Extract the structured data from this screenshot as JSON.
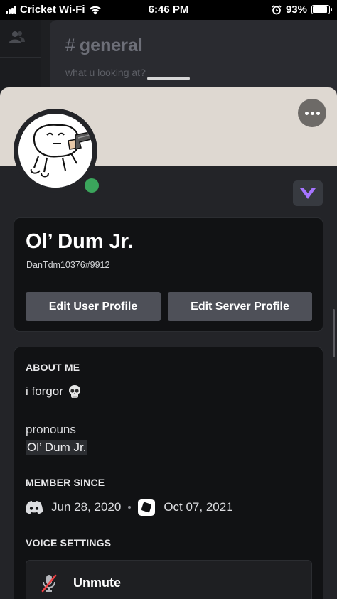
{
  "status_bar": {
    "carrier": "Cricket Wi-Fi",
    "time": "6:46 PM",
    "battery": "93%"
  },
  "background": {
    "channel_name": "general",
    "channel_topic": "what u looking at?"
  },
  "profile": {
    "display_name": "Ol’ Dum Jr.",
    "username": "DanTdm10376#9912",
    "status": "online",
    "banner_color": "#ded8d1",
    "buttons": {
      "edit_user": "Edit User Profile",
      "edit_server": "Edit Server Profile"
    },
    "about": {
      "heading": "ABOUT ME",
      "text": "i forgor",
      "emoji": "skull-icon",
      "pronouns_label": "pronouns",
      "pronouns_value": "Ol’ Dum Jr."
    },
    "member_since": {
      "heading": "MEMBER SINCE",
      "discord_date": "Jun 28, 2020",
      "server_date": "Oct 07, 2021"
    },
    "voice": {
      "heading": "VOICE SETTINGS",
      "unmute_label": "Unmute"
    }
  },
  "colors": {
    "online": "#3ba55c",
    "nitro": "#a674ff",
    "button": "#4e5058",
    "mute_red": "#ed4245"
  }
}
